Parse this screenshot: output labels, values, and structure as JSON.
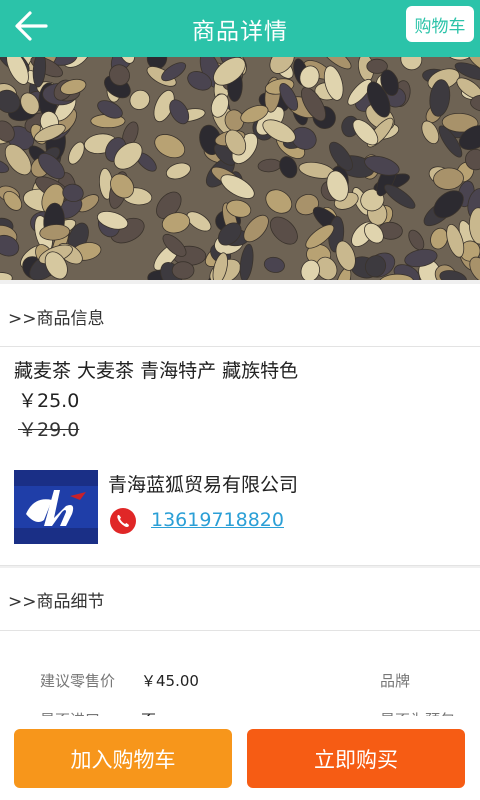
{
  "header": {
    "title": "商品详情",
    "back_icon": "arrow-left-icon",
    "cart_label": "购物车"
  },
  "product_image": {
    "description_icon": "product-photo"
  },
  "section_info": {
    "title": ">>商品信息"
  },
  "product": {
    "name": "藏麦茶 大麦茶 青海特产 藏族特色",
    "price": "￥25.0",
    "old_price": "￥29.0"
  },
  "shop": {
    "name": "青海蓝狐贸易有限公司",
    "phone": "13619718820",
    "phone_icon": "phone-icon",
    "logo_icon": "shop-logo"
  },
  "section_detail": {
    "title": ">>商品细节"
  },
  "specs": [
    {
      "label": "建议零售价",
      "value": "￥45.00"
    },
    {
      "label": "品牌",
      "value": ""
    },
    {
      "label": "是否进口",
      "value": "否"
    },
    {
      "label": "是否为预包",
      "value": ""
    }
  ],
  "actions": {
    "add_cart": "加入购物车",
    "buy_now": "立即购买"
  },
  "colors": {
    "header": "#2bc3a9",
    "add_cart": "#f7961b",
    "buy_now": "#f65c14",
    "link": "#2b9fd6"
  }
}
